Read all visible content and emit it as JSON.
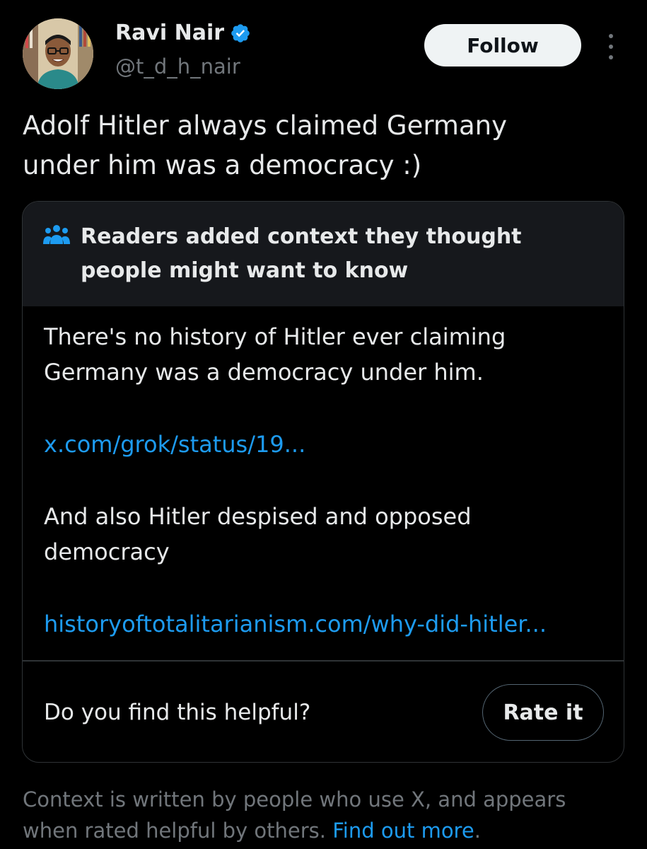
{
  "author": {
    "display_name": "Ravi Nair",
    "handle": "@t_d_h_nair",
    "verified_icon": "verified-badge-icon"
  },
  "follow_button": {
    "label": "Follow"
  },
  "more_menu": {
    "icon": "more-options-icon"
  },
  "tweet": {
    "text_lines": [
      "Adolf Hitler always claimed Germany",
      "under him was a democracy :)"
    ]
  },
  "community_note": {
    "header_icon": "readers-group-icon",
    "title_lines": [
      "Readers added context they thought",
      "people might want to know"
    ],
    "paragraph1_lines": [
      "There's no history of Hitler ever claiming",
      "Germany was a democracy under him."
    ],
    "link1": "x.com/grok/status/19...",
    "paragraph2_lines": [
      "And also Hitler despised and opposed",
      "democracy"
    ],
    "link2": "historyoftotalitarianism.com/why-did-hitler...",
    "helpful_question": "Do you find this helpful?",
    "rate_button_label": "Rate it"
  },
  "footer": {
    "text_line1": "Context is written by people who use X, and appears",
    "text_line2": "when rated helpful by others.",
    "link": "Find out more",
    "link_suffix": "."
  },
  "colors": {
    "background": "#000000",
    "text_primary": "#e7e9ea",
    "text_secondary": "#71767b",
    "link": "#1d9bf0",
    "border": "#2f3336",
    "note_header_bg": "#16181c",
    "verified": "#1d9bf0"
  }
}
